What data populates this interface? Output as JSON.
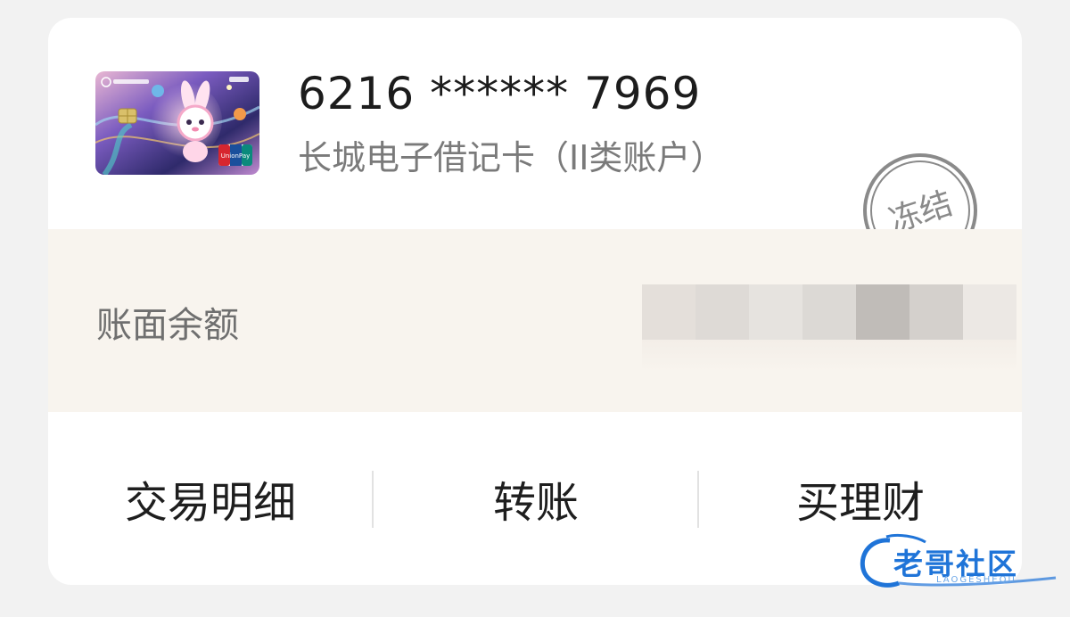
{
  "account": {
    "number": "6216 ****** 7969",
    "type": "长城电子借记卡（II类账户）",
    "status_stamp": "冻结"
  },
  "card_image": {
    "icon": "debit-card-artwork",
    "network_logo_text": "UnionPay",
    "colors": [
      "#2f2a6b",
      "#6a4fb0",
      "#e28fb7",
      "#f4c66b"
    ]
  },
  "balance": {
    "label": "账面余额",
    "value_blurred": true
  },
  "actions": [
    {
      "label": "交易明细"
    },
    {
      "label": "转账"
    },
    {
      "label": "买理财"
    }
  ],
  "watermark": {
    "text": "老哥社区",
    "subtext": "LAOGESHEQU"
  },
  "colors": {
    "page_bg": "#f2f2f2",
    "card_bg": "#ffffff",
    "balance_bg": "#f8f4ee",
    "primary_text": "#1c1c1c",
    "secondary_text": "#7a7a7a",
    "stamp": "#8a8a8a"
  }
}
